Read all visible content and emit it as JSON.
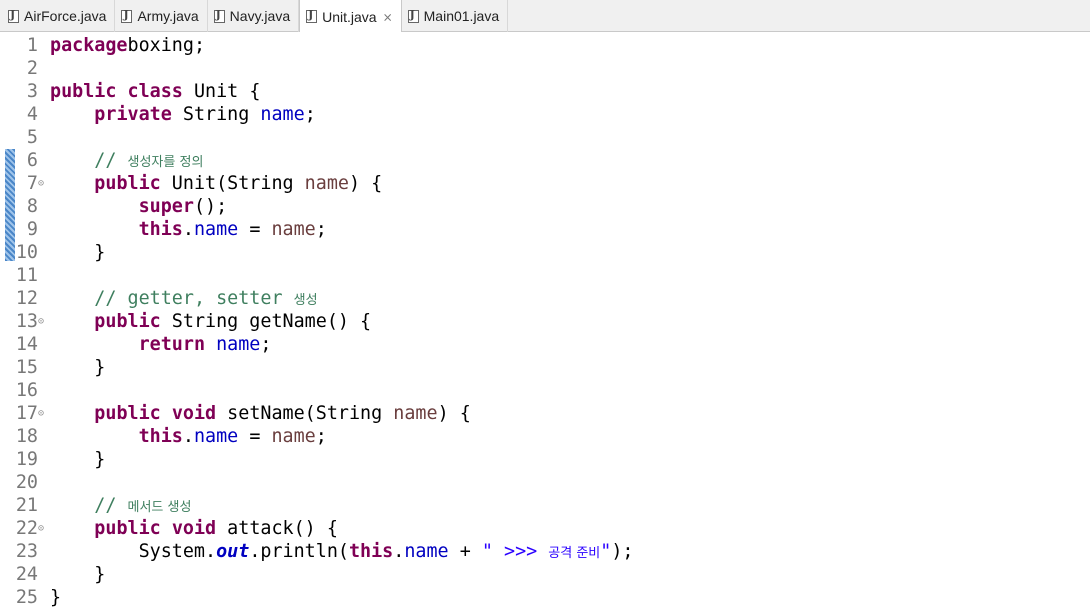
{
  "tabs": [
    {
      "label": "AirForce.java",
      "active": false
    },
    {
      "label": "Army.java",
      "active": false
    },
    {
      "label": "Navy.java",
      "active": false
    },
    {
      "label": "Unit.java",
      "active": true,
      "close": "⨯"
    },
    {
      "label": "Main01.java",
      "active": false
    }
  ],
  "colors": {
    "keyword": "#7f0055",
    "field": "#0000c0",
    "parameter": "#6a3e3e",
    "comment": "#3f7f5f",
    "string": "#2a00ff",
    "line_number": "#787878",
    "change_bar": "#4a86c8"
  },
  "editor": {
    "lines": [
      {
        "n": "1",
        "fold": false,
        "segs": [
          [
            "kw",
            "package"
          ],
          [
            "",
            "boxing;"
          ]
        ]
      },
      {
        "n": "2",
        "fold": false,
        "segs": []
      },
      {
        "n": "3",
        "fold": false,
        "segs": [
          [
            "kw",
            "public"
          ],
          [
            "",
            " "
          ],
          [
            "kw",
            "class"
          ],
          [
            "",
            " Unit {"
          ]
        ]
      },
      {
        "n": "4",
        "fold": false,
        "segs": [
          [
            "",
            "    "
          ],
          [
            "kw",
            "private"
          ],
          [
            "",
            " String "
          ],
          [
            "fld",
            "name"
          ],
          [
            "",
            ";"
          ]
        ]
      },
      {
        "n": "5",
        "fold": false,
        "segs": []
      },
      {
        "n": "6",
        "fold": false,
        "segs": [
          [
            "",
            "    "
          ],
          [
            "cmt",
            "// "
          ],
          [
            "cmt ko",
            "생성자를 정의"
          ]
        ]
      },
      {
        "n": "7",
        "fold": true,
        "segs": [
          [
            "",
            "    "
          ],
          [
            "kw",
            "public"
          ],
          [
            "",
            " Unit(String "
          ],
          [
            "par",
            "name"
          ],
          [
            "",
            ") {"
          ]
        ]
      },
      {
        "n": "8",
        "fold": false,
        "segs": [
          [
            "",
            "        "
          ],
          [
            "kw",
            "super"
          ],
          [
            "",
            "();"
          ]
        ]
      },
      {
        "n": "9",
        "fold": false,
        "segs": [
          [
            "",
            "        "
          ],
          [
            "kw",
            "this"
          ],
          [
            "",
            "."
          ],
          [
            "fld",
            "name"
          ],
          [
            "",
            " = "
          ],
          [
            "par",
            "name"
          ],
          [
            "",
            ";"
          ]
        ]
      },
      {
        "n": "10",
        "fold": false,
        "segs": [
          [
            "",
            "    }"
          ]
        ]
      },
      {
        "n": "11",
        "fold": false,
        "segs": []
      },
      {
        "n": "12",
        "fold": false,
        "segs": [
          [
            "",
            "    "
          ],
          [
            "cmt",
            "// getter, setter "
          ],
          [
            "cmt ko",
            "생성"
          ]
        ]
      },
      {
        "n": "13",
        "fold": true,
        "segs": [
          [
            "",
            "    "
          ],
          [
            "kw",
            "public"
          ],
          [
            "",
            " String getName() {"
          ]
        ]
      },
      {
        "n": "14",
        "fold": false,
        "segs": [
          [
            "",
            "        "
          ],
          [
            "kw",
            "return"
          ],
          [
            "",
            " "
          ],
          [
            "fld",
            "name"
          ],
          [
            "",
            ";"
          ]
        ]
      },
      {
        "n": "15",
        "fold": false,
        "segs": [
          [
            "",
            "    }"
          ]
        ]
      },
      {
        "n": "16",
        "fold": false,
        "segs": []
      },
      {
        "n": "17",
        "fold": true,
        "segs": [
          [
            "",
            "    "
          ],
          [
            "kw",
            "public"
          ],
          [
            "",
            " "
          ],
          [
            "kw",
            "void"
          ],
          [
            "",
            " setName(String "
          ],
          [
            "par",
            "name"
          ],
          [
            "",
            ") {"
          ]
        ]
      },
      {
        "n": "18",
        "fold": false,
        "segs": [
          [
            "",
            "        "
          ],
          [
            "kw",
            "this"
          ],
          [
            "",
            "."
          ],
          [
            "fld",
            "name"
          ],
          [
            "",
            " = "
          ],
          [
            "par",
            "name"
          ],
          [
            "",
            ";"
          ]
        ]
      },
      {
        "n": "19",
        "fold": false,
        "segs": [
          [
            "",
            "    }"
          ]
        ]
      },
      {
        "n": "20",
        "fold": false,
        "segs": []
      },
      {
        "n": "21",
        "fold": false,
        "segs": [
          [
            "",
            "    "
          ],
          [
            "cmt",
            "// "
          ],
          [
            "cmt ko",
            "메서드 생성"
          ]
        ]
      },
      {
        "n": "22",
        "fold": true,
        "segs": [
          [
            "",
            "    "
          ],
          [
            "kw",
            "public"
          ],
          [
            "",
            " "
          ],
          [
            "kw",
            "void"
          ],
          [
            "",
            " attack() {"
          ]
        ]
      },
      {
        "n": "23",
        "fold": false,
        "segs": [
          [
            "",
            "        System."
          ],
          [
            "stat",
            "out"
          ],
          [
            "",
            ".println("
          ],
          [
            "kw",
            "this"
          ],
          [
            "",
            "."
          ],
          [
            "fld",
            "name"
          ],
          [
            "",
            " + "
          ],
          [
            "str",
            "\" >>> "
          ],
          [
            "str ko",
            "공격 준비"
          ],
          [
            "str",
            "\""
          ],
          [
            "",
            ");"
          ]
        ]
      },
      {
        "n": "24",
        "fold": false,
        "segs": [
          [
            "",
            "    }"
          ]
        ]
      },
      {
        "n": "25",
        "fold": false,
        "segs": [
          [
            "",
            "}"
          ]
        ]
      }
    ]
  }
}
